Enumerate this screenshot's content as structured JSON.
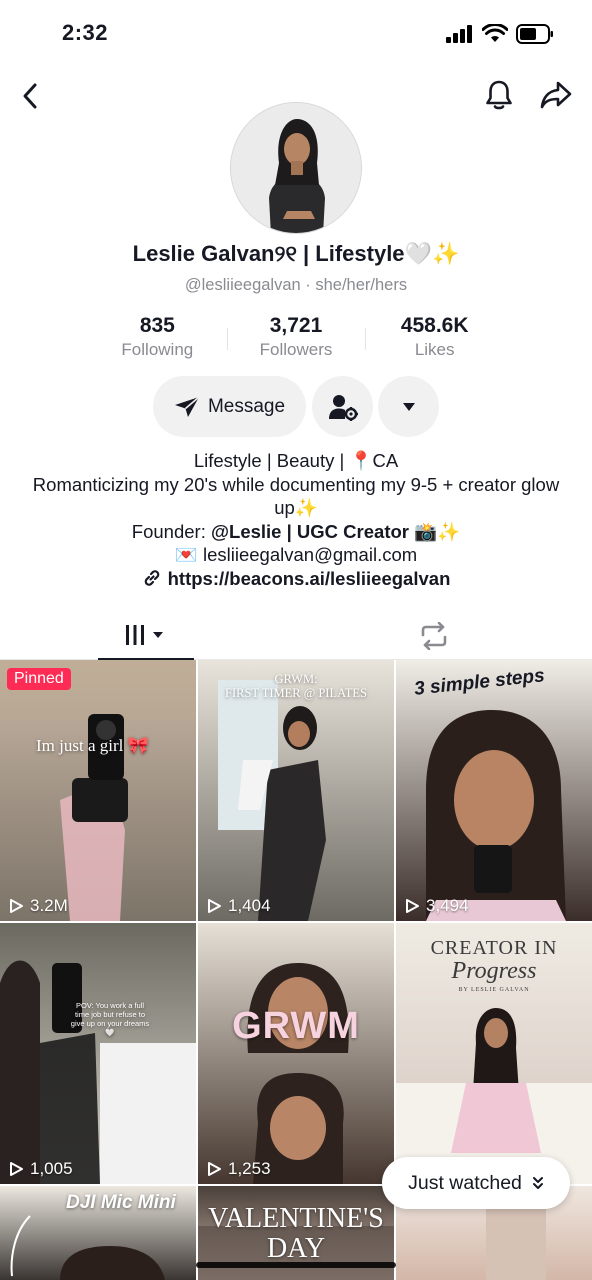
{
  "status_bar": {
    "time": "2:32"
  },
  "profile": {
    "display_name": "Leslie Galvan୨୧ | Lifestyle🤍✨",
    "handle_line": "@lesliieegalvan · she/her/hers"
  },
  "stats": [
    {
      "value": "835",
      "label": "Following"
    },
    {
      "value": "3,721",
      "label": "Followers"
    },
    {
      "value": "458.6K",
      "label": "Likes"
    }
  ],
  "actions": {
    "message_label": "Message"
  },
  "bio": {
    "line1": "Lifestyle | Beauty | 📍CA",
    "line2": "Romanticizing my 20's while documenting my 9-5 + creator glow up✨",
    "line3_prefix": "Founder: ",
    "line3_bold": "@Leslie | UGC Creator 📸✨",
    "line4": "💌 lesliieegalvan@gmail.com",
    "link": "https://beacons.ai/lesliieegalvan"
  },
  "videos": [
    {
      "views": "3.2M",
      "pinned_label": "Pinned",
      "overlay": "Im just a girl 🎀",
      "colors": [
        "#c9b6a5",
        "#7c7468"
      ]
    },
    {
      "views": "1,404",
      "overlay_top": "GRWM:",
      "overlay_bottom": "FIRST TIMER @ PILATES",
      "colors": [
        "#e9e4db",
        "#6d6a63"
      ]
    },
    {
      "views": "3,494",
      "overlay": "3 simple steps",
      "colors": [
        "#f0ece6",
        "#3b2e2a"
      ]
    },
    {
      "views": "1,005",
      "overlay": "POV: You work a full time job but refuse to give up on your dreams🤍",
      "colors": [
        "#6b6a60",
        "#d9d5cc"
      ]
    },
    {
      "views": "1,253",
      "overlay": "GRWM",
      "colors": [
        "#e6e0d6",
        "#45372f"
      ]
    },
    {
      "views": "",
      "overlay_top": "CREATOR IN",
      "overlay_bottom": "Progress",
      "overlay_small": "BY LESLIE GALVAN",
      "colors": [
        "#efebe3",
        "#d4c4bd"
      ]
    },
    {
      "views": "",
      "overlay": "DJI Mic Mini",
      "colors": [
        "#ece8e0",
        "#3a3532"
      ]
    },
    {
      "views": "",
      "overlay_top": "VALENTINE'S",
      "overlay_bottom": "DAY",
      "colors": [
        "#4a403a",
        "#cab5a8"
      ]
    },
    {
      "views": "",
      "colors": [
        "#efe6df",
        "#d3b7a8"
      ]
    }
  ],
  "just_watched": {
    "label": "Just watched"
  },
  "icons": {
    "back": "chevron-left-icon",
    "bell": "bell-icon",
    "share": "share-arrow-icon",
    "message": "paper-plane-icon",
    "user_settings": "person-gear-icon",
    "more": "triangle-down-icon",
    "videos_tab": "grid-bars-icon",
    "reposts_tab": "repost-icon",
    "play": "play-outline-icon"
  },
  "colors": {
    "pinned_bg": "#fe2c55",
    "text_primary": "#161823",
    "text_secondary": "#8a8b91"
  }
}
